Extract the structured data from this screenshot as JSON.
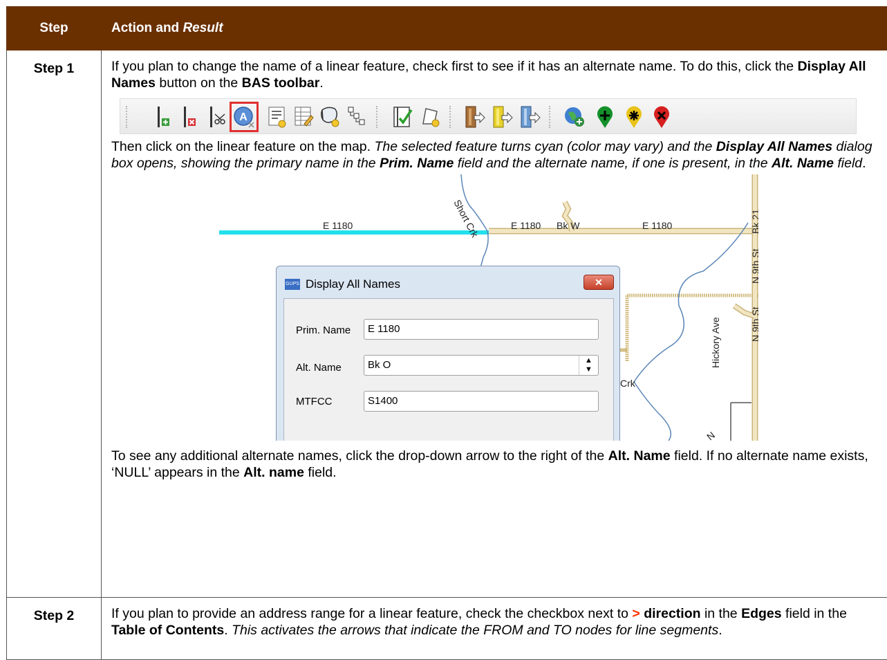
{
  "header": {
    "step": "Step",
    "action": "Action and ",
    "result": "Result"
  },
  "step1": {
    "label": "Step 1",
    "p1": {
      "t1": "If you plan to change the name of a linear feature, check first to see if it has an alternate name. To do this, click the ",
      "b1": "Display All Names",
      "t2": " button on the ",
      "b2": "BAS toolbar",
      "t3": "."
    },
    "toolbar": {
      "icons": [
        "add-edge-icon",
        "delete-edge-icon",
        "split-edge-icon",
        "display-all-names-icon",
        "edit-attributes-icon",
        "table-edit-icon",
        "polygon-attributes-icon",
        "topology-icon",
        "validate-icon",
        "new-polygon-icon",
        "import-1-icon",
        "import-2-icon",
        "import-3-icon",
        "add-globe-icon",
        "add-point-icon",
        "move-point-icon",
        "delete-point-icon"
      ],
      "selected": "display-all-names-icon"
    },
    "p2": {
      "t1": "Then click on the linear feature on the map. ",
      "i1": "The selected feature turns cyan (color may vary) and the ",
      "bi1": "Display All Names",
      "i2": " dialog box opens, showing the primary name in the ",
      "bi2": "Prim. Name",
      "i3": " field and the alternate name, if one is present, in the ",
      "bi3": "Alt. Name",
      "i4": " field",
      "t2": "."
    },
    "map": {
      "labels": {
        "short_crk": "Short Crk",
        "e1180_a": "E 1180",
        "e1180_b": "E 1180",
        "bk_w": "Bk W",
        "e1180_c": "E 1180",
        "bk21": "Bk 21",
        "n9th_a": "N 9th St",
        "n9th_b": "N 9th St",
        "hickory": "Hickory Ave",
        "crk": "Crk",
        "n": "N"
      },
      "colors": {
        "selected": "#22e0ec",
        "road": "#f2e6c2",
        "road_edge": "#c9b37a",
        "stream": "#5b86b8",
        "boundary": "#c9b06a"
      }
    },
    "dialog": {
      "title": "Display All Names",
      "app_icon": "GUPS",
      "close": "✕",
      "prim_label": "Prim. Name",
      "prim_value": "E 1180",
      "alt_label": "Alt. Name",
      "alt_value": "Bk O",
      "mtfcc_label": "MTFCC",
      "mtfcc_value": "S1400"
    },
    "p3": {
      "t1": "To see any additional alternate names, click the drop-down arrow to the right of the ",
      "b1": "Alt. Name",
      "t2": " field. If no alternate name exists, ‘NULL’ appears in the ",
      "b2": "Alt. name",
      "t3": " field."
    }
  },
  "step2": {
    "label": "Step 2",
    "p1": {
      "t1": "If you plan to provide an address range for a linear feature, check the checkbox next to ",
      "o1": ">",
      "b1": "direction",
      "t2": " in the ",
      "b2": "Edges",
      "t3": " field in the ",
      "b3": "Table of Contents",
      "t4": ". ",
      "i1": "This activates the arrows that indicate the FROM and TO nodes for line segments",
      "t5": "."
    }
  }
}
